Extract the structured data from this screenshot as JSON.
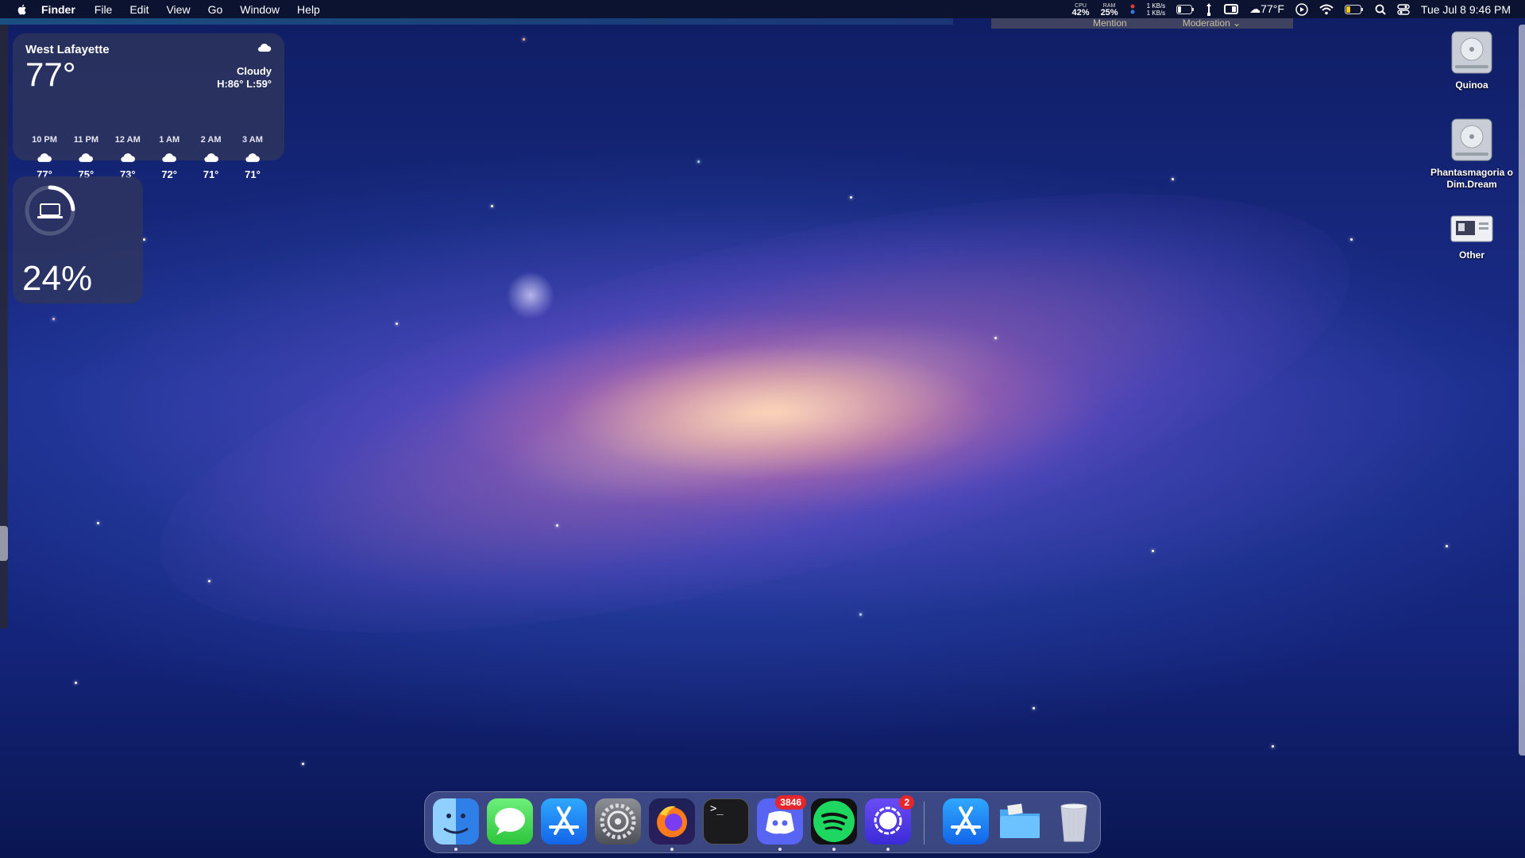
{
  "menubar": {
    "app_name": "Finder",
    "menus": [
      "File",
      "Edit",
      "View",
      "Go",
      "Window",
      "Help"
    ],
    "cpu": {
      "label": "CPU",
      "value": "42%"
    },
    "ram": {
      "label": "RAM",
      "value": "25%"
    },
    "net_up": "1 KB/s",
    "net_down": "1 KB/s",
    "weather": "77°F",
    "datetime": "Tue Jul 8  9:46 PM"
  },
  "background_strip": {
    "mention": "Mention",
    "moderation": "Moderation ⌄"
  },
  "weather_widget": {
    "city": "West Lafayette",
    "temp": "77°",
    "condition": "Cloudy",
    "hilo": "H:86° L:59°",
    "hours": [
      {
        "time": "10 PM",
        "temp": "77°"
      },
      {
        "time": "11 PM",
        "temp": "75°"
      },
      {
        "time": "12 AM",
        "temp": "73°"
      },
      {
        "time": "1 AM",
        "temp": "72°"
      },
      {
        "time": "2 AM",
        "temp": "71°"
      },
      {
        "time": "3 AM",
        "temp": "71°"
      }
    ]
  },
  "battery_widget": {
    "percent_text": "24%",
    "level": 0.24
  },
  "desktop_icons": [
    {
      "label": "Quinoa",
      "icon": "hard-drive-icon"
    },
    {
      "label": "Phantasmagoria o Dim.Dream",
      "icon": "hard-drive-icon"
    },
    {
      "label": "Other",
      "icon": "disk-image-icon"
    }
  ],
  "dock": {
    "items": [
      {
        "name": "Finder",
        "icon": "finder-icon"
      },
      {
        "name": "Messages",
        "icon": "messages-icon"
      },
      {
        "name": "App Store",
        "icon": "app-store-icon"
      },
      {
        "name": "System Settings",
        "icon": "system-settings-icon"
      },
      {
        "name": "Firefox",
        "icon": "firefox-icon"
      },
      {
        "name": "Terminal",
        "icon": "terminal-icon"
      },
      {
        "name": "Discord",
        "icon": "discord-icon",
        "badge": "3846"
      },
      {
        "name": "Spotify",
        "icon": "spotify-icon"
      },
      {
        "name": "Signal",
        "icon": "signal-icon",
        "badge": "2"
      },
      {
        "name": "App Store",
        "icon": "app-store-icon"
      },
      {
        "name": "Downloads",
        "icon": "folder-icon"
      },
      {
        "name": "Trash",
        "icon": "trash-icon"
      }
    ],
    "terminal_prompt": ">_"
  },
  "colors": {
    "menubar": "#0c1330",
    "badge": "#e5262a",
    "widget_bg": "#32375a"
  }
}
